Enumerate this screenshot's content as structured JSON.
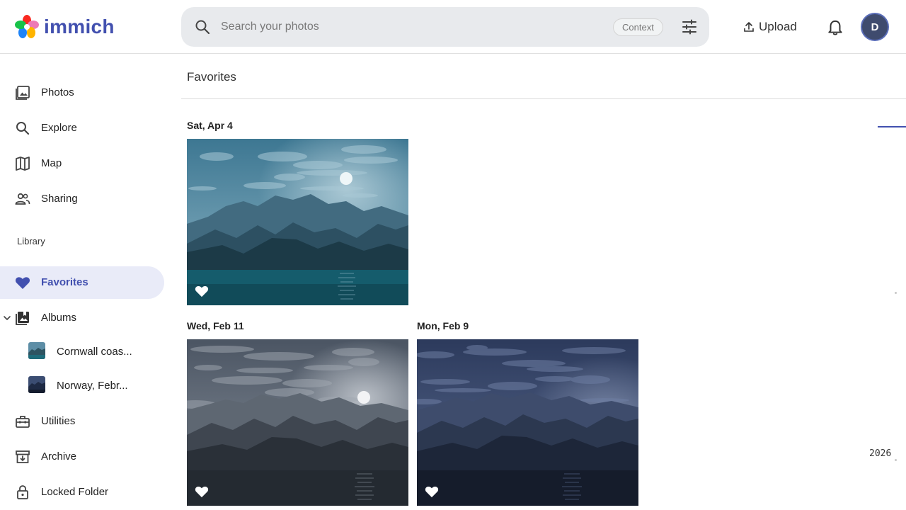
{
  "app": {
    "name": "immich"
  },
  "header": {
    "search_placeholder": "Search your photos",
    "search_value": "",
    "context_label": "Context",
    "upload_label": "Upload",
    "avatar_initial": "D"
  },
  "sidebar": {
    "items": [
      {
        "label": "Photos",
        "icon": "photos-icon"
      },
      {
        "label": "Explore",
        "icon": "search-icon"
      },
      {
        "label": "Map",
        "icon": "map-icon"
      },
      {
        "label": "Sharing",
        "icon": "people-icon"
      }
    ],
    "library_label": "Library",
    "library_items": [
      {
        "label": "Favorites",
        "icon": "heart-icon",
        "active": true
      },
      {
        "label": "Albums",
        "icon": "album-icon"
      }
    ],
    "albums": [
      {
        "label": "Cornwall coas..."
      },
      {
        "label": "Norway, Febr..."
      }
    ],
    "more_items": [
      {
        "label": "Utilities",
        "icon": "toolbox-icon"
      },
      {
        "label": "Archive",
        "icon": "archive-icon"
      },
      {
        "label": "Locked Folder",
        "icon": "lock-icon"
      }
    ]
  },
  "main": {
    "title": "Favorites",
    "groups": [
      {
        "date": "Sat, Apr 4"
      },
      {
        "date": "Wed, Feb 11"
      },
      {
        "date": "Mon, Feb 9"
      }
    ],
    "timeline_year": "2026"
  },
  "colors": {
    "accent": "#4250af",
    "active_bg": "#e9ebf8",
    "search_bg": "#e8eaed"
  }
}
